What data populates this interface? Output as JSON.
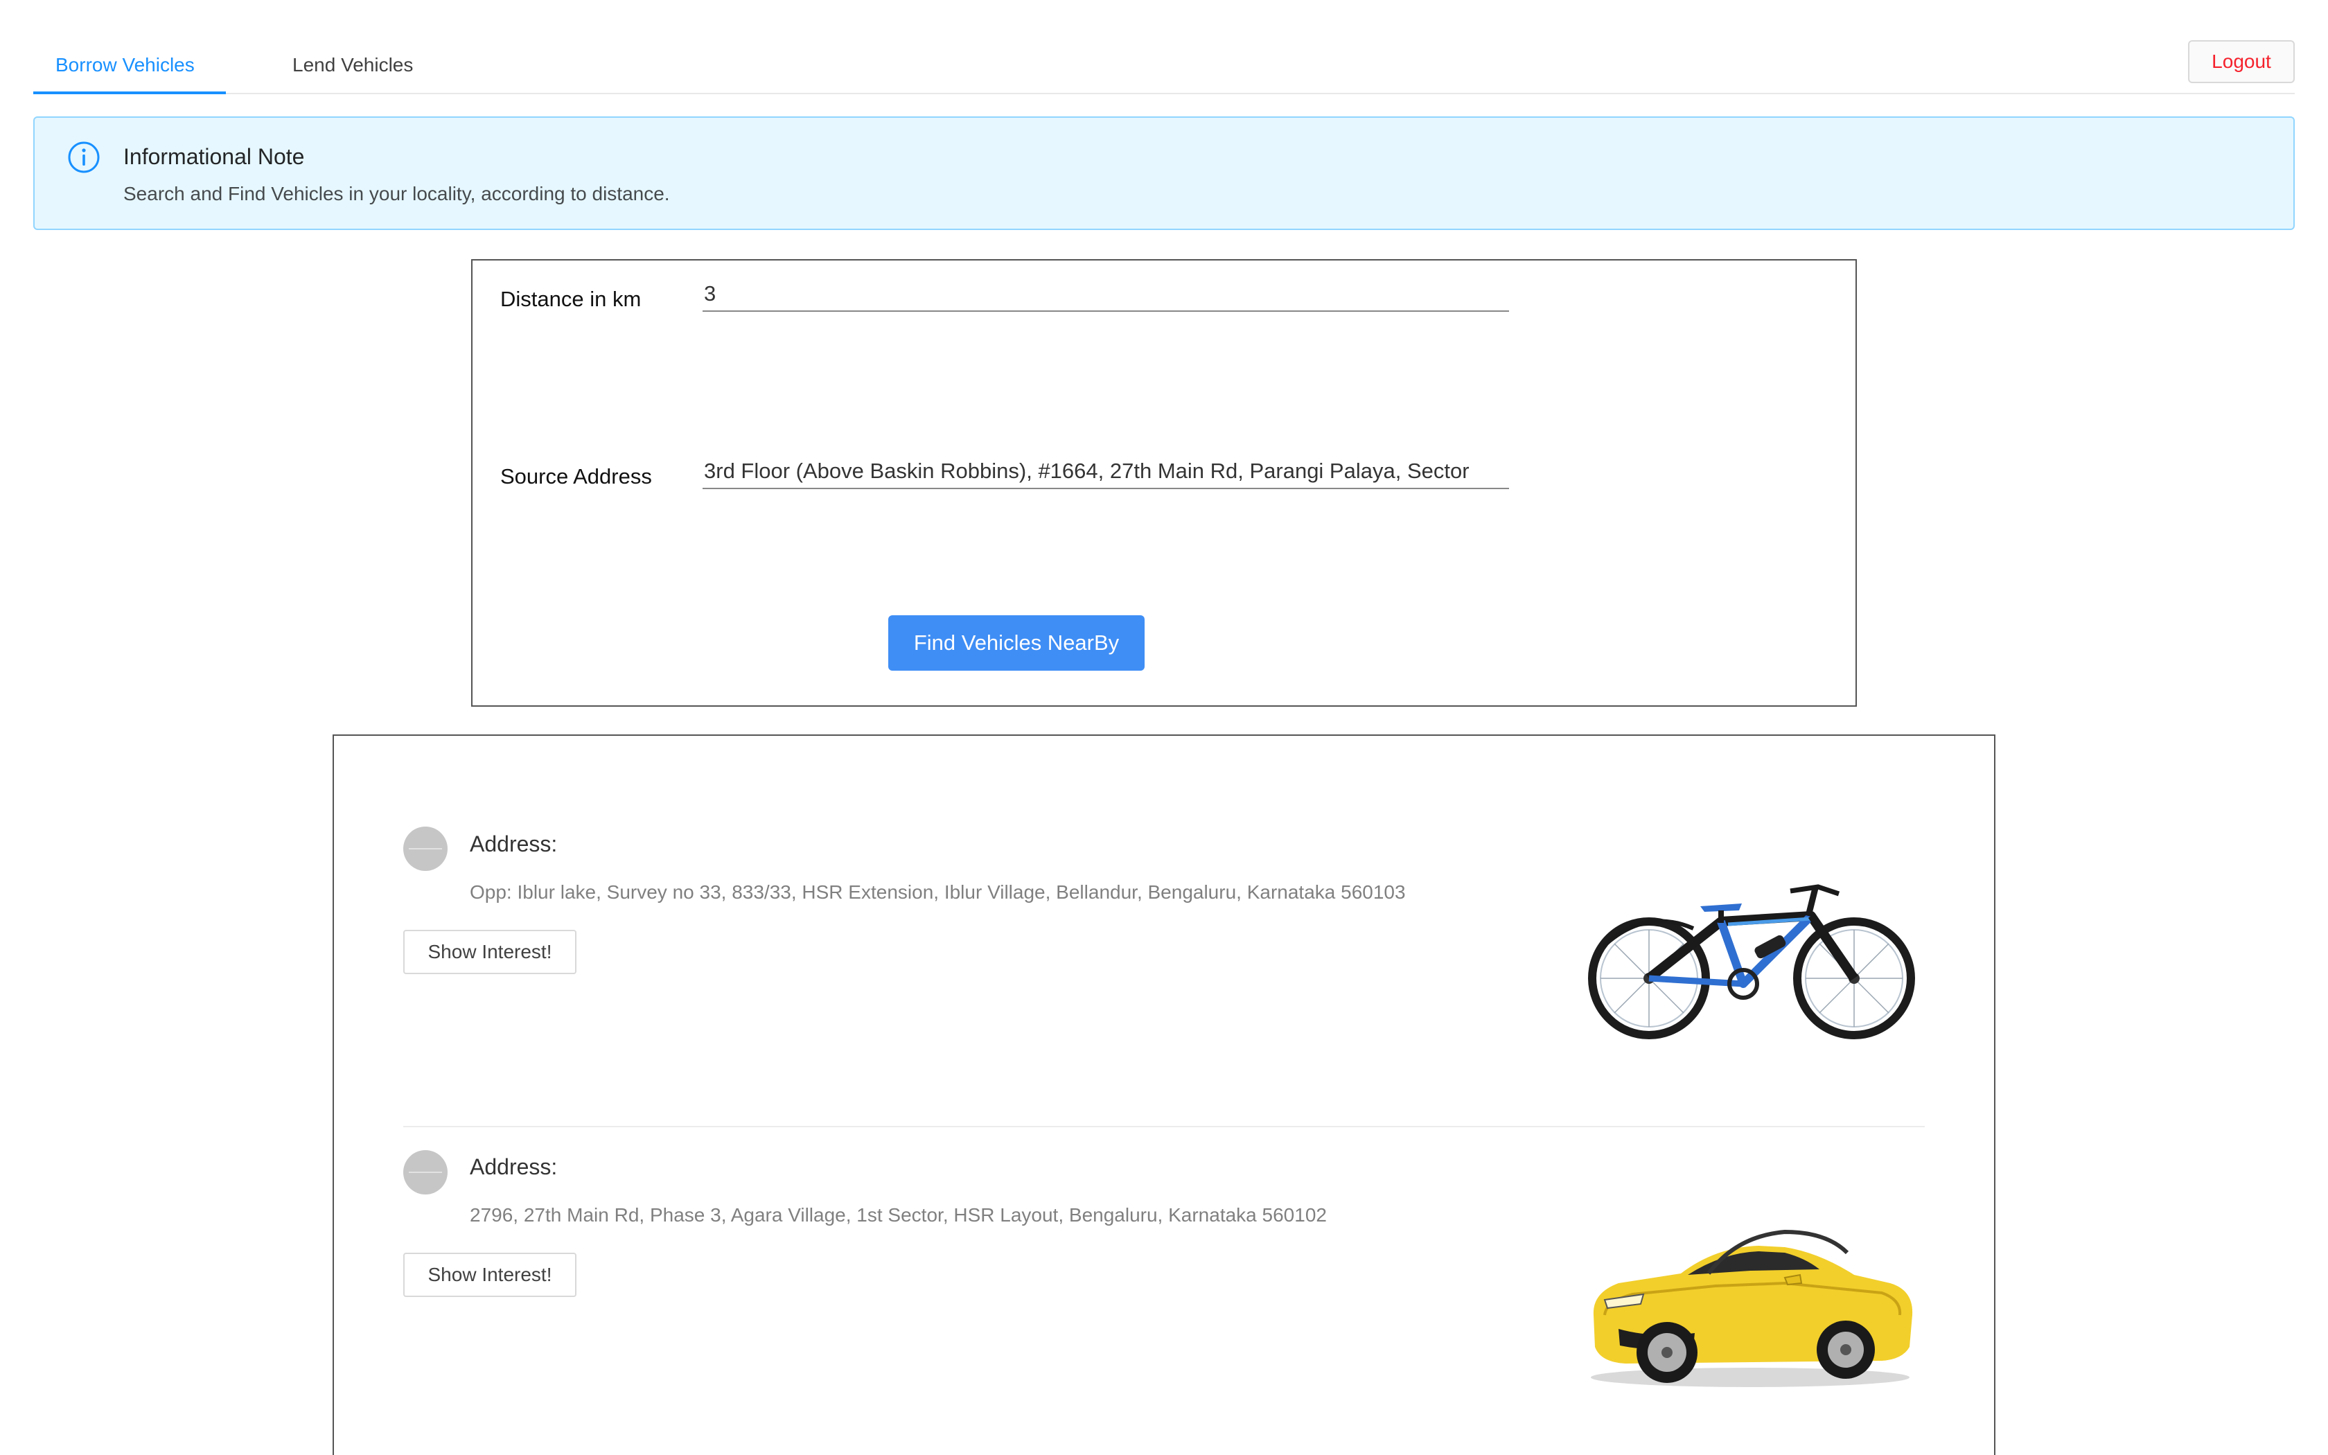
{
  "tabs": {
    "borrow": "Borrow Vehicles",
    "lend": "Lend Vehicles",
    "active": "borrow"
  },
  "header": {
    "logout_label": "Logout"
  },
  "alert": {
    "title": "Informational Note",
    "description": "Search and Find Vehicles in your locality, according to distance."
  },
  "search": {
    "distance_label": "Distance in km",
    "distance_value": "3",
    "address_label": "Source Address",
    "address_value": "3rd Floor (Above Baskin Robbins), #1664, 27th Main Rd, Parangi Palaya, Sector",
    "submit_label": "Find Vehicles NearBy"
  },
  "results": [
    {
      "address_heading": "Address:",
      "address": "Opp: Iblur lake, Survey no 33, 833/33, HSR Extension, Iblur Village, Bellandur, Bengaluru, Karnataka 560103",
      "action_label": "Show Interest!",
      "vehicle_icon": "bicycle-image"
    },
    {
      "address_heading": "Address:",
      "address": "2796, 27th Main Rd, Phase 3, Agara Village, 1st Sector, HSR Layout, Bengaluru, Karnataka 560102",
      "action_label": "Show Interest!",
      "vehicle_icon": "car-image"
    }
  ],
  "colors": {
    "primary": "#1890ff",
    "button_blue": "#3f8ef5",
    "danger": "#f5222d",
    "alert_bg": "#e6f7ff",
    "alert_border": "#91d5ff",
    "bike_frame": "#2f6fd1",
    "car_body": "#f2cf2b"
  }
}
